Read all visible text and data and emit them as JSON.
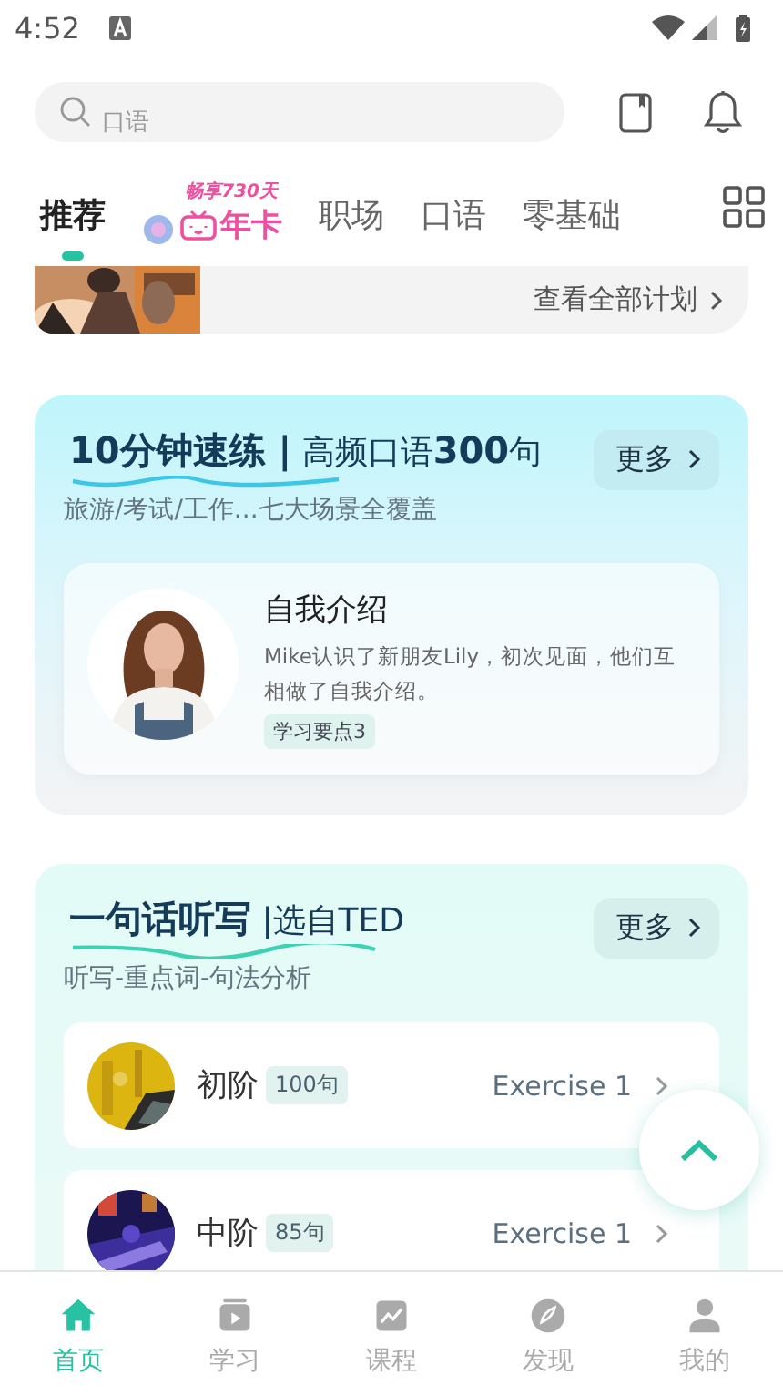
{
  "status_bar": {
    "time": "4:52"
  },
  "search": {
    "placeholder": "口语"
  },
  "tabs": [
    {
      "kind": "text",
      "label": "推荐",
      "selected": true
    },
    {
      "kind": "promo",
      "top": "畅享730天",
      "label": "年卡",
      "selected": false
    },
    {
      "kind": "text",
      "label": "职场",
      "selected": false
    },
    {
      "kind": "text",
      "label": "口语",
      "selected": false
    },
    {
      "kind": "text",
      "label": "零基础",
      "selected": false
    }
  ],
  "plan_strip": {
    "link": "查看全部计划"
  },
  "speaking_card": {
    "title": "**10分钟速练 |** 高频口语**300**句",
    "more": "更多",
    "subtitle": "旅游/考试/工作...七大场景全覆盖",
    "lesson": {
      "title": "自我介绍",
      "description": "Mike认识了新朋友Lily，初次见面，他们互相做了自我介绍。",
      "tag": "学习要点3"
    }
  },
  "dictation_card": {
    "title": "**一句话听写** |选自TED",
    "more": "更多",
    "subtitle": "听写-重点词-句法分析",
    "levels": [
      {
        "name": "初阶",
        "count": "100句",
        "exercise": "Exercise 1"
      },
      {
        "name": "中阶",
        "count": "85句",
        "exercise": "Exercise 1"
      }
    ]
  },
  "nav": [
    {
      "label": "首页",
      "selected": true
    },
    {
      "label": "学习",
      "selected": false
    },
    {
      "label": "课程",
      "selected": false
    },
    {
      "label": "发现",
      "selected": false
    },
    {
      "label": "我的",
      "selected": false
    }
  ]
}
